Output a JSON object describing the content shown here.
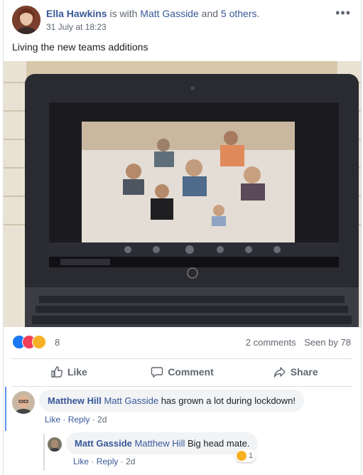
{
  "post": {
    "author": "Ella Hawkins",
    "is_with_text": "is with",
    "tagged": "Matt Gasside",
    "and_text": "and",
    "others": "5 others",
    "period": ".",
    "timestamp": "31 July at 18:23",
    "text": "Living the new teams additions",
    "more_label": "•••"
  },
  "reactions": {
    "count": "8",
    "types": [
      "like",
      "love",
      "haha"
    ],
    "colors": {
      "like": "#1877f2",
      "love": "#f33e58",
      "haha": "#f7b125"
    }
  },
  "stats": {
    "comments": "2 comments",
    "seen": "Seen by 78"
  },
  "actions": {
    "like": "Like",
    "comment": "Comment",
    "share": "Share"
  },
  "comments": [
    {
      "author": "Matthew Hill",
      "tag": "Matt Gasside",
      "text": "has grown a lot during lockdown!",
      "like": "Like",
      "reply": "Reply",
      "time": "2d",
      "sep": "·"
    },
    {
      "author": "Matt Gasside",
      "tag": "Matthew Hill",
      "text": "Big head mate.",
      "like": "Like",
      "reply": "Reply",
      "time": "2d",
      "sep": "·",
      "reaction_count": "1"
    }
  ],
  "colors": {
    "link": "#385898",
    "muted": "#606770",
    "accent": "#1877f2"
  }
}
